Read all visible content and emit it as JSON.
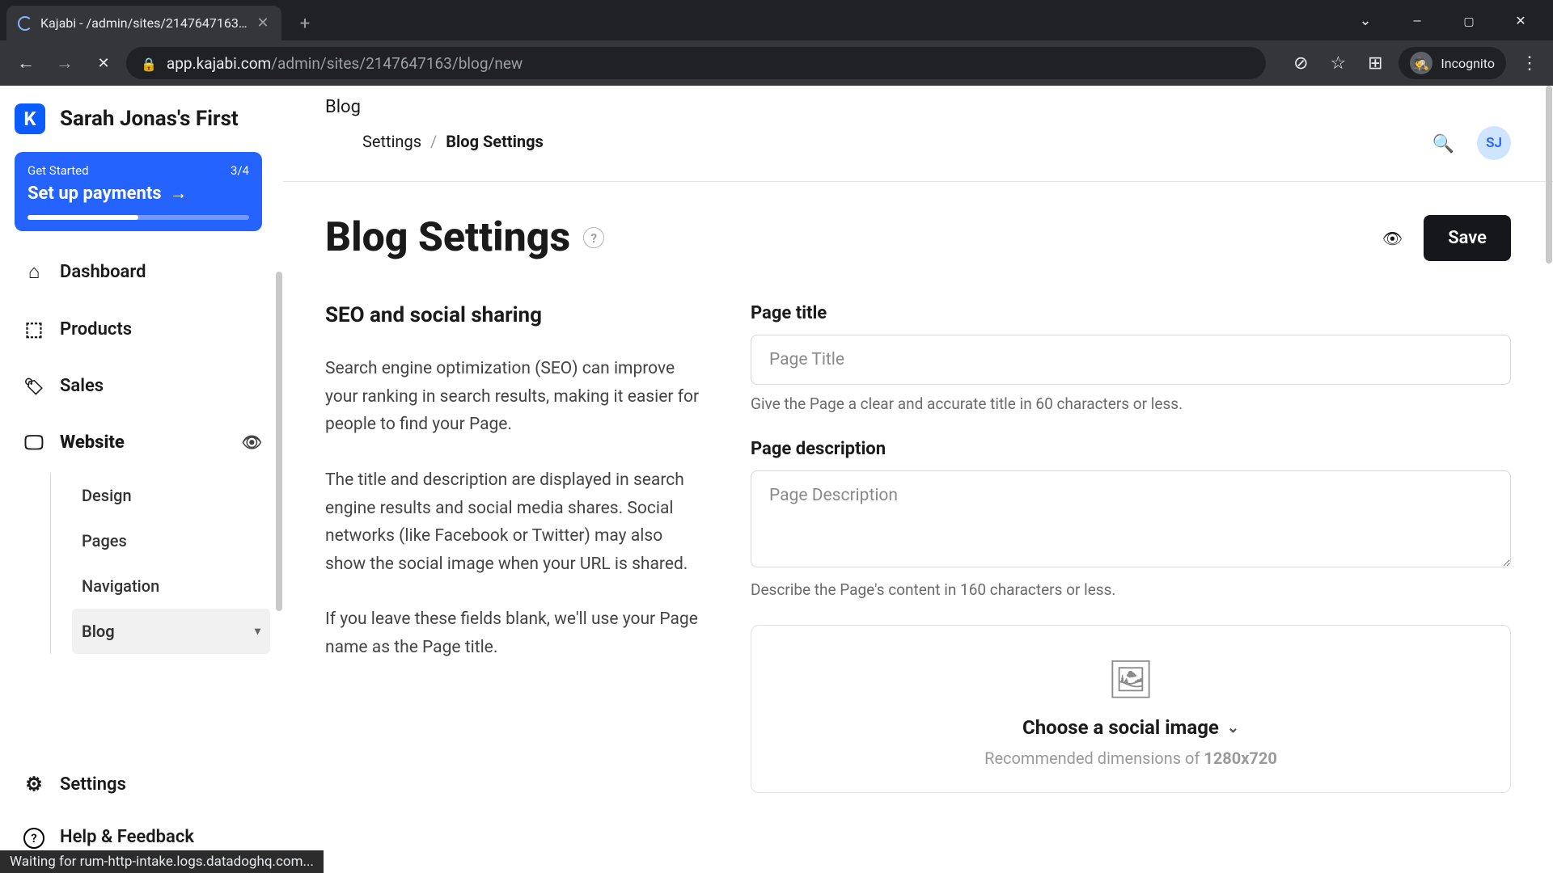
{
  "browser": {
    "tab_title": "Kajabi - /admin/sites/2147647163...",
    "url_domain": "app.kajabi.com",
    "url_path": "/admin/sites/2147647163/blog/new",
    "incognito_label": "Incognito"
  },
  "brand": {
    "logo_letter": "K",
    "site_name": "Sarah Jonas's First"
  },
  "onboard": {
    "kicker": "Get Started",
    "progress_label": "3/4",
    "title": "Set up payments",
    "progress_pct": 50
  },
  "sidebar": {
    "items": [
      {
        "label": "Dashboard"
      },
      {
        "label": "Products"
      },
      {
        "label": "Sales"
      },
      {
        "label": "Website"
      }
    ],
    "website_sub": [
      {
        "label": "Design"
      },
      {
        "label": "Pages"
      },
      {
        "label": "Navigation"
      },
      {
        "label": "Blog"
      }
    ],
    "footer": {
      "settings": "Settings",
      "help": "Help & Feedback"
    }
  },
  "header": {
    "section": "Blog",
    "crumb1": "Settings",
    "crumb2": "Blog Settings",
    "avatar": "SJ"
  },
  "page": {
    "title": "Blog Settings",
    "save": "Save"
  },
  "seo": {
    "heading": "SEO and social sharing",
    "p1": "Search engine optimization (SEO) can improve your ranking in search results, making it easier for people to find your Page.",
    "p2": "The title and description are displayed in search engine results and social media shares. Social networks (like Facebook or Twitter) may also show the social image when your URL is shared.",
    "p3": "If you leave these fields blank, we'll use your Page name as the Page title."
  },
  "form": {
    "title_label": "Page title",
    "title_placeholder": "Page Title",
    "title_hint": "Give the Page a clear and accurate title in 60 characters or less.",
    "desc_label": "Page description",
    "desc_placeholder": "Page Description",
    "desc_hint": "Describe the Page's content in 160 characters or less.",
    "image_choose": "Choose a social image",
    "image_rec_prefix": "Recommended dimensions of ",
    "image_rec_strong": "1280x720"
  },
  "status_bar": "Waiting for rum-http-intake.logs.datadoghq.com..."
}
